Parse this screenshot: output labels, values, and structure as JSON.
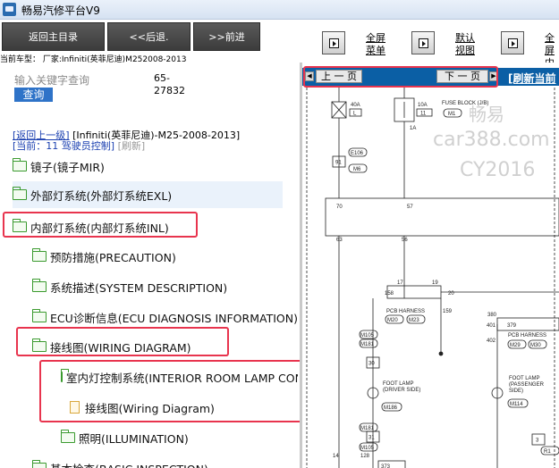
{
  "app": {
    "title": "畅易汽修平台V9"
  },
  "toolbar": {
    "home_label": "返回主目录",
    "back_label": "<<后退.",
    "forward_label": ">>前进",
    "fullscreen_1": "全屏",
    "fullscreen_2": "菜单",
    "default_1": "默认",
    "default_2": "视图",
    "fullscreen_content_1": "全屏",
    "fullscreen_content_2": "内容"
  },
  "vehicle": {
    "text": "当前车型：  厂家:Infiniti(英菲尼迪)M252008-2013"
  },
  "search": {
    "placeholder": "输入关键字查询",
    "count": "65-27832",
    "button_label": "查询"
  },
  "breadcrumb": {
    "back_link": "[返回上一级]",
    "path": "[Infiniti(英菲尼迪)-M25-2008-2013]",
    "current": "[当前：11 驾驶员控制]",
    "refresh": "[刷新]"
  },
  "tree": [
    {
      "label": "镜子(镜子MIR)",
      "type": "folder"
    },
    {
      "label": "外部灯系统(外部灯系统EXL)",
      "type": "folder"
    },
    {
      "label": "内部灯系统(内部灯系统INL)",
      "type": "folder"
    },
    {
      "label": "预防措施(PRECAUTION)",
      "type": "folder"
    },
    {
      "label": "系统描述(SYSTEM DESCRIPTION)",
      "type": "folder"
    },
    {
      "label": "ECU诊断信息(ECU DIAGNOSIS INFORMATION)",
      "type": "folder"
    },
    {
      "label": "接线图(WIRING DIAGRAM)",
      "type": "folder"
    },
    {
      "label": "室内灯控制系统(INTERIOR ROOM LAMP CONTROL SYSTEM)",
      "type": "folder"
    },
    {
      "label": "接线图(Wiring Diagram)",
      "type": "doc"
    },
    {
      "label": "照明(ILLUMINATION)",
      "type": "folder"
    },
    {
      "label": "基本检查(BASIC INSPECTION)",
      "type": "folder"
    }
  ],
  "viewer": {
    "prev_label": "上 一 页",
    "next_label": "下 一 页",
    "refresh_label": "[刷新当前",
    "watermark_1": "畅易",
    "watermark_2": "car388.com",
    "watermark_3": "CY2016",
    "diagram": {
      "fuse_block": "FUSE BLOCK (J/B)",
      "fuse1_amp": "40A",
      "fuse1_code": "L",
      "fuse2_amp": "10A",
      "fuse2_code": "11",
      "m1": "M1",
      "n1a": "1A",
      "e106": "E106",
      "n91": "91",
      "m6": "M6",
      "n70": "70",
      "n57": "57",
      "n63": "63",
      "n56": "56",
      "n17": "17",
      "n19": "19",
      "n158": "158",
      "n20": "20",
      "pcb1": "PCB HARNESS",
      "m20": "M20",
      "m23": "M23",
      "n159": "159",
      "m105a": "M105",
      "m181a": "M181",
      "n30": "30",
      "foot1_a": "FOOT LAMP",
      "foot1_b": "(DRIVER SIDE)",
      "m186": "M186",
      "m181b": "M181",
      "n31": "31",
      "m105b": "M105",
      "n380": "380",
      "n379": "379",
      "n401": "401",
      "pcb2": "PCB HARNESS",
      "n402": "402",
      "m29": "M29",
      "m30": "M30",
      "foot2_a": "FOOT LAMP",
      "foot2_b": "(PASSENGER",
      "foot2_c": "SIDE)",
      "m114": "M114",
      "n3": "3",
      "r1": "R1",
      "n14": "14",
      "n128": "128",
      "n373": "373"
    }
  }
}
